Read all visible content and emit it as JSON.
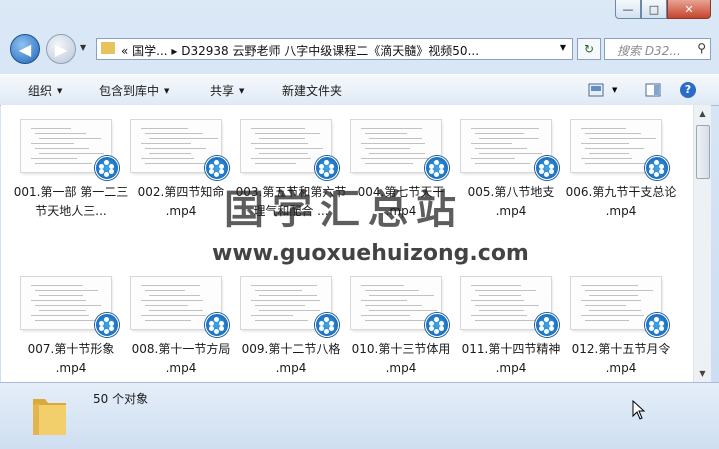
{
  "window": {
    "caption_buttons": [
      "—",
      "□",
      "✕"
    ]
  },
  "nav": {
    "back_glyph": "◀",
    "forward_glyph": "▶",
    "address_path": "«  国学...  ▸  D32938  云野老师 八字中级课程二《滴天髓》视频50...",
    "address_dropdown": "▼",
    "search_placeholder": "搜索 D32...",
    "refresh_glyph": "↻"
  },
  "toolbar": {
    "organize": "组织",
    "include_library": "包含到库中",
    "share": "共享",
    "new_folder": "新建文件夹",
    "view_icon": "view-icon",
    "help_glyph": "?"
  },
  "files": [
    {
      "name": "001.第一部 第一二三节天地人三..."
    },
    {
      "name": "002.第四节知命 .mp4"
    },
    {
      "name": "003.第五节和第六节理气和配合 ..."
    },
    {
      "name": "004.第七节天干 .mp4"
    },
    {
      "name": "005.第八节地支 .mp4"
    },
    {
      "name": "006.第九节干支总论 .mp4"
    },
    {
      "name": "007.第十节形象 .mp4"
    },
    {
      "name": "008.第十一节方局 .mp4"
    },
    {
      "name": "009.第十二节八格 .mp4"
    },
    {
      "name": "010.第十三节体用 .mp4"
    },
    {
      "name": "011.第十四节精神 .mp4"
    },
    {
      "name": "012.第十五节月令 .mp4"
    }
  ],
  "watermark": {
    "title": "国学汇总站",
    "url": "www.guoxuehuizong.com"
  },
  "status": {
    "count_text": "50 个对象"
  },
  "colors": {
    "accent": "#1f65b8",
    "folder": "#e8c25b",
    "close": "#c5452d"
  }
}
